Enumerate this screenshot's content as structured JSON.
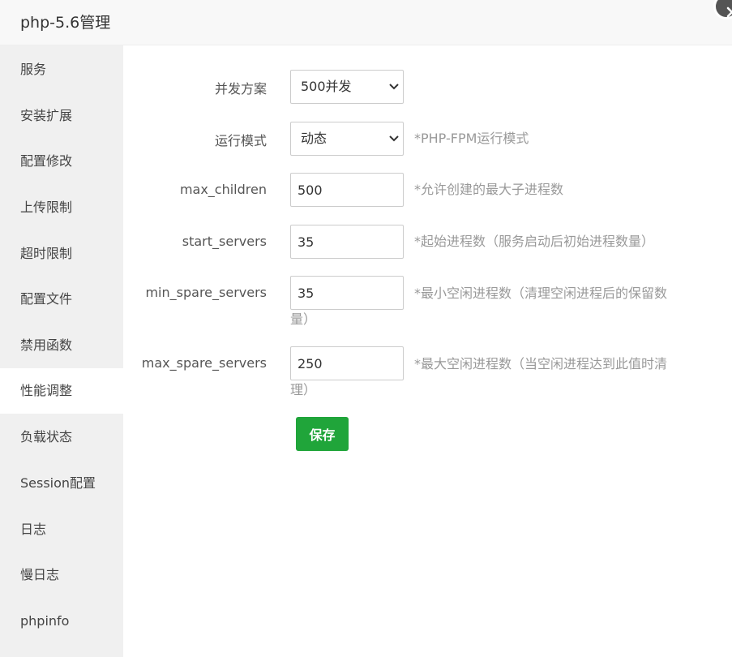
{
  "dialog": {
    "title": "php-5.6管理"
  },
  "sidebar": {
    "items": [
      {
        "label": "服务"
      },
      {
        "label": "安装扩展"
      },
      {
        "label": "配置修改"
      },
      {
        "label": "上传限制"
      },
      {
        "label": "超时限制"
      },
      {
        "label": "配置文件"
      },
      {
        "label": "禁用函数"
      },
      {
        "label": "性能调整",
        "active": true
      },
      {
        "label": "负载状态"
      },
      {
        "label": "Session配置"
      },
      {
        "label": "日志"
      },
      {
        "label": "慢日志"
      },
      {
        "label": "phpinfo"
      }
    ]
  },
  "form": {
    "concurrency": {
      "label": "并发方案",
      "value": "500并发"
    },
    "mode": {
      "label": "运行模式",
      "value": "动态",
      "help": "*PHP-FPM运行模式"
    },
    "max_children": {
      "label": "max_children",
      "value": "500",
      "help": "*允许创建的最大子进程数"
    },
    "start_servers": {
      "label": "start_servers",
      "value": "35",
      "help": "*起始进程数（服务启动后初始进程数量）"
    },
    "min_spare_servers": {
      "label": "min_spare_servers",
      "value": "35",
      "help_line1": "*最小空闲进程数（清理空闲进程后的保留数",
      "help_line2": "量）"
    },
    "max_spare_servers": {
      "label": "max_spare_servers",
      "value": "250",
      "help_line1": "*最大空闲进程数（当空闲进程达到此值时清",
      "help_line2": "理）"
    },
    "save_label": "保存"
  },
  "colors": {
    "accent": "#20a53a",
    "sidebar_bg": "#f0f0f0",
    "help_text": "#999999"
  },
  "icons": {
    "close": "close-icon",
    "dropdown": "chevron-down-icon"
  }
}
